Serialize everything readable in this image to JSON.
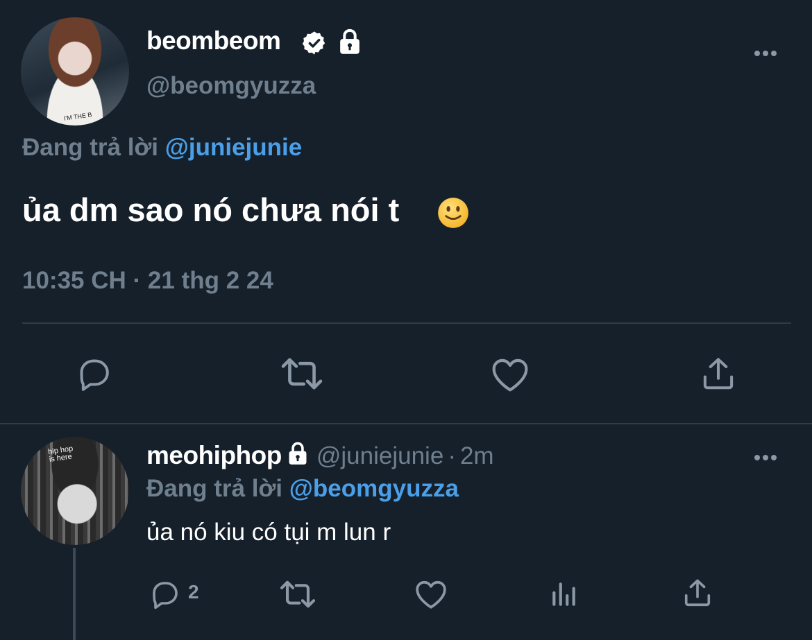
{
  "tweet": {
    "display_name": "beombeom",
    "handle": "@beomgyuzza",
    "replying_prefix": "Đang trả lời ",
    "replying_to": "@juniejunie",
    "text": "ủa dm sao nó chưa nói t",
    "emoji": "slightly-smiling-face",
    "timestamp": "10:35 CH · 21 thg 2 24",
    "avatar_text": "I'M THE B"
  },
  "reply": {
    "display_name": "meohiphop",
    "handle": "@juniejunie",
    "separator": "·",
    "time_ago": "2m",
    "replying_prefix": "Đang trả lời ",
    "replying_to": "@beomgyuzza",
    "text": "ủa nó kiu có tụi m lun r",
    "reply_count": "2",
    "avatar_text": "hip hop is here"
  },
  "colors": {
    "background": "#16202b",
    "muted": "#6f7f8d",
    "accent": "#4a9fe8",
    "icon": "#8b98a5"
  },
  "icons": [
    "verified-badge-icon",
    "lock-icon",
    "more-icon",
    "reply-icon",
    "retweet-icon",
    "like-icon",
    "share-icon",
    "analytics-icon"
  ]
}
